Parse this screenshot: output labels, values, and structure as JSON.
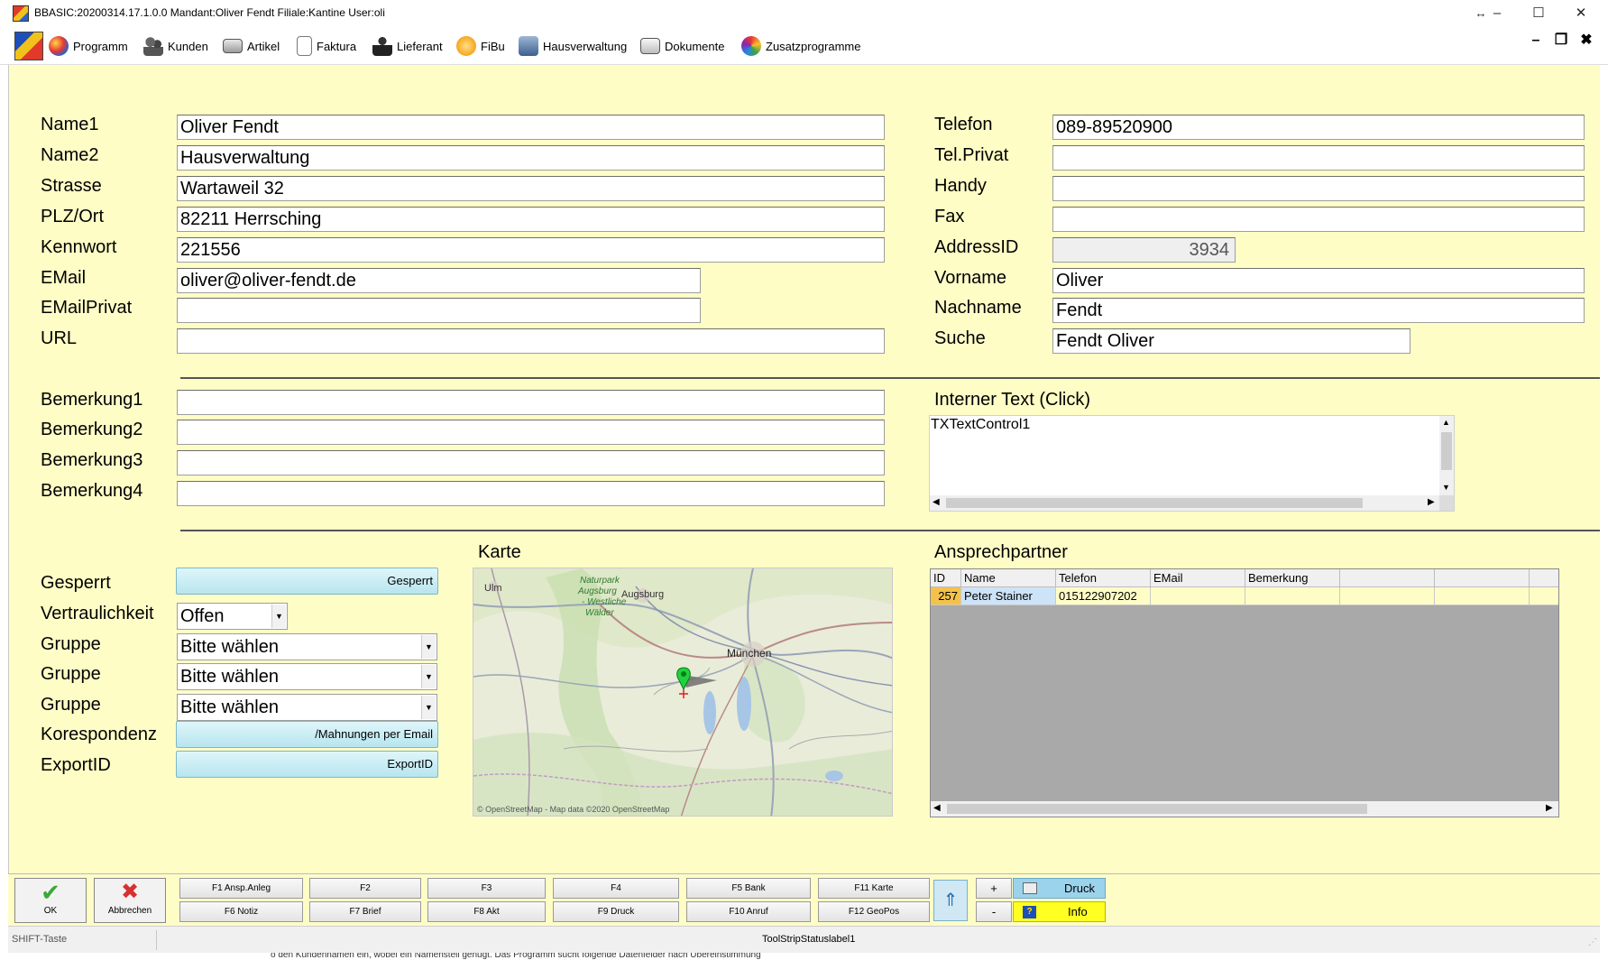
{
  "window": {
    "title": "BBASIC:20200314.17.1.0.0 Mandant:Oliver Fendt Filiale:Kantine User:oli",
    "resize_glyph": "↔",
    "min_glyph": "–",
    "max_glyph": "☐",
    "close_glyph": "✕"
  },
  "menu": {
    "items": [
      {
        "label": "Programm",
        "icon": "globe-icon"
      },
      {
        "label": "Kunden",
        "icon": "people-icon"
      },
      {
        "label": "Artikel",
        "icon": "cart-icon"
      },
      {
        "label": "Faktura",
        "icon": "document-icon"
      },
      {
        "label": "Lieferant",
        "icon": "person-icon"
      },
      {
        "label": "FiBu",
        "icon": "coins-icon"
      },
      {
        "label": "Hausverwaltung",
        "icon": "building-icon"
      },
      {
        "label": "Dokumente",
        "icon": "folder-icon"
      },
      {
        "label": "Zusatzprogramme",
        "icon": "puzzle-icon"
      }
    ],
    "mdi_min": "–",
    "mdi_restore": "❐",
    "mdi_close": "✖"
  },
  "address": {
    "labels": {
      "name1": "Name1",
      "name2": "Name2",
      "strasse": "Strasse",
      "plz_ort": "PLZ/Ort",
      "kennwort": "Kennwort",
      "email": "EMail",
      "email_privat": "EMailPrivat",
      "url": "URL",
      "telefon": "Telefon",
      "tel_privat": "Tel.Privat",
      "handy": "Handy",
      "fax": "Fax",
      "address_id": "AddressID",
      "vorname": "Vorname",
      "nachname": "Nachname",
      "suche": "Suche"
    },
    "values": {
      "name1": "Oliver Fendt",
      "name2": "Hausverwaltung",
      "strasse": "Wartaweil 32",
      "plz_ort": "82211 Herrsching",
      "kennwort": "221556",
      "email": "oliver@oliver-fendt.de",
      "email_privat": "",
      "url": "",
      "telefon": "089-89520900",
      "tel_privat": "",
      "handy": "",
      "fax": "",
      "address_id": "3934",
      "vorname": "Oliver",
      "nachname": "Fendt",
      "suche": "Fendt Oliver"
    }
  },
  "remarks": {
    "labels": [
      "Bemerkung1",
      "Bemerkung2",
      "Bemerkung3",
      "Bemerkung4"
    ],
    "values": [
      "",
      "",
      "",
      ""
    ],
    "internal_label": "Interner Text (Click)",
    "internal_text": "TXTextControl1"
  },
  "settings": {
    "labels": {
      "gesperrt": "Gesperrt",
      "vertraulichkeit": "Vertraulichkeit",
      "gruppe1": "Gruppe",
      "gruppe2": "Gruppe",
      "gruppe3": "Gruppe",
      "korespondenz": "Korespondenz",
      "export_id": "ExportID"
    },
    "gesperrt_button": "Gesperrt",
    "vertraulichkeit_value": "Offen",
    "gruppe_values": [
      "Bitte wählen",
      "Bitte wählen",
      "Bitte wählen"
    ],
    "korespondenz_button": "/Mahnungen per Email",
    "export_button": "ExportID"
  },
  "map": {
    "label": "Karte",
    "places": [
      "Naturpark",
      "Augsburg",
      "- Westliche",
      "Wälder",
      "Augsburg",
      "Ulm",
      "München"
    ],
    "attribution": "© OpenStreetMap - Map data ©2020 OpenStreetMap"
  },
  "contacts": {
    "label": "Ansprechpartner",
    "columns": [
      "ID",
      "Name",
      "Telefon",
      "EMail",
      "Bemerkung",
      "",
      ""
    ],
    "rows": [
      {
        "id": "257",
        "name": "Peter Stainer",
        "telefon": "015122907202",
        "email": "",
        "bemerkung": ""
      }
    ]
  },
  "toolbar": {
    "ok_label": "OK",
    "cancel_label": "Abbrechen",
    "fkeys_top": [
      "F1 Ansp.Anleg",
      "F2",
      "F3",
      "F4",
      "F5 Bank",
      "F11 Karte"
    ],
    "fkeys_bottom": [
      "F6 Notiz",
      "F7 Brief",
      "F8 Akt",
      "F9 Druck",
      "F10 Anruf",
      "F12 GeoPos"
    ],
    "plus": "+",
    "minus": "-",
    "druck_label": "Druck",
    "info_label": "Info"
  },
  "status": {
    "left": "SHIFT-Taste",
    "center": "ToolStripStatuslabel1",
    "bottom_text": "o    den Kundennamen ein, wobei ein Namensteil genügt. Das Programm sucht folgende Datenfelder nach Übereinstimmung"
  }
}
